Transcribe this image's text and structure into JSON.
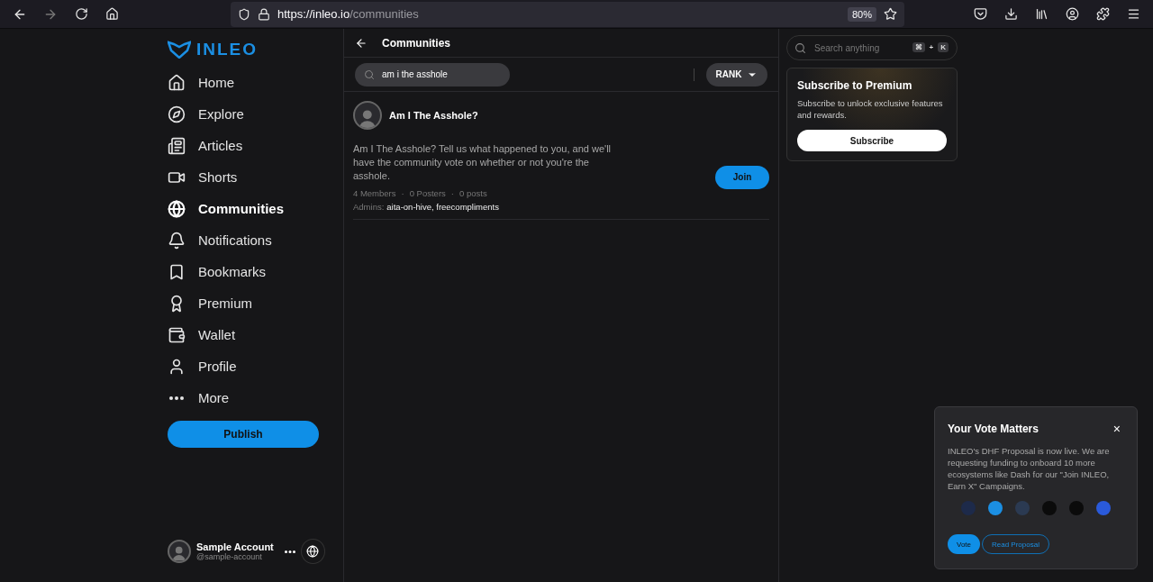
{
  "browser": {
    "url_host": "https://inleo.io",
    "url_path": "/communities",
    "zoom": "80%"
  },
  "sidebar": {
    "logo": "INLEO",
    "items": [
      {
        "kind": "home",
        "label": "Home",
        "selected": false
      },
      {
        "kind": "explore",
        "label": "Explore",
        "selected": false
      },
      {
        "kind": "articles",
        "label": "Articles",
        "selected": false
      },
      {
        "kind": "shorts",
        "label": "Shorts",
        "selected": false
      },
      {
        "kind": "communities",
        "label": "Communities",
        "selected": true
      },
      {
        "kind": "notifications",
        "label": "Notifications",
        "selected": false
      },
      {
        "kind": "bookmarks",
        "label": "Bookmarks",
        "selected": false
      },
      {
        "kind": "premium",
        "label": "Premium",
        "selected": false
      },
      {
        "kind": "wallet",
        "label": "Wallet",
        "selected": false
      },
      {
        "kind": "profile",
        "label": "Profile",
        "selected": false
      },
      {
        "kind": "more",
        "label": "More",
        "selected": false
      }
    ],
    "publish": "Publish",
    "account": {
      "name": "Sample Account",
      "handle": "@sample-account"
    }
  },
  "main": {
    "title": "Communities",
    "search": {
      "value": "am i the asshole"
    },
    "sort": "RANK",
    "communities": [
      {
        "name": "Am I The Asshole?",
        "description": "Am I The Asshole? Tell us what happened to you, and we'll have the community vote on whether or not you're the asshole.",
        "separator": "·",
        "members": "4 Members",
        "posters": "0 Posters",
        "posts": "0 posts",
        "admins_label": "Admins:",
        "admins": "aita-on-hive, freecompliments",
        "join": "Join"
      }
    ]
  },
  "right": {
    "search": {
      "placeholder": "Search anything",
      "keys": [
        "⌘",
        "+",
        "K"
      ]
    },
    "premium": {
      "title": "Subscribe to Premium",
      "text": "Subscribe to unlock exclusive features and rewards.",
      "button": "Subscribe"
    }
  },
  "popup": {
    "title": "Your Vote Matters",
    "close": "×",
    "text": "INLEO's DHF Proposal is now live. We are requesting funding to onboard 10 more ecosystems like Dash for our \"Join INLEO, Earn X\" Campaigns.",
    "logos": [
      {
        "color": "#1d2a4a"
      },
      {
        "color": "#1b8fe3"
      },
      {
        "color": "#2b3a52"
      },
      {
        "color": "#0b0b0b"
      },
      {
        "color": "#0b0b0b"
      },
      {
        "color": "#2a5ada"
      }
    ],
    "buttons": [
      {
        "label": "Vote",
        "kind": "primary"
      },
      {
        "label": "Read Proposal",
        "kind": "outline"
      }
    ]
  }
}
